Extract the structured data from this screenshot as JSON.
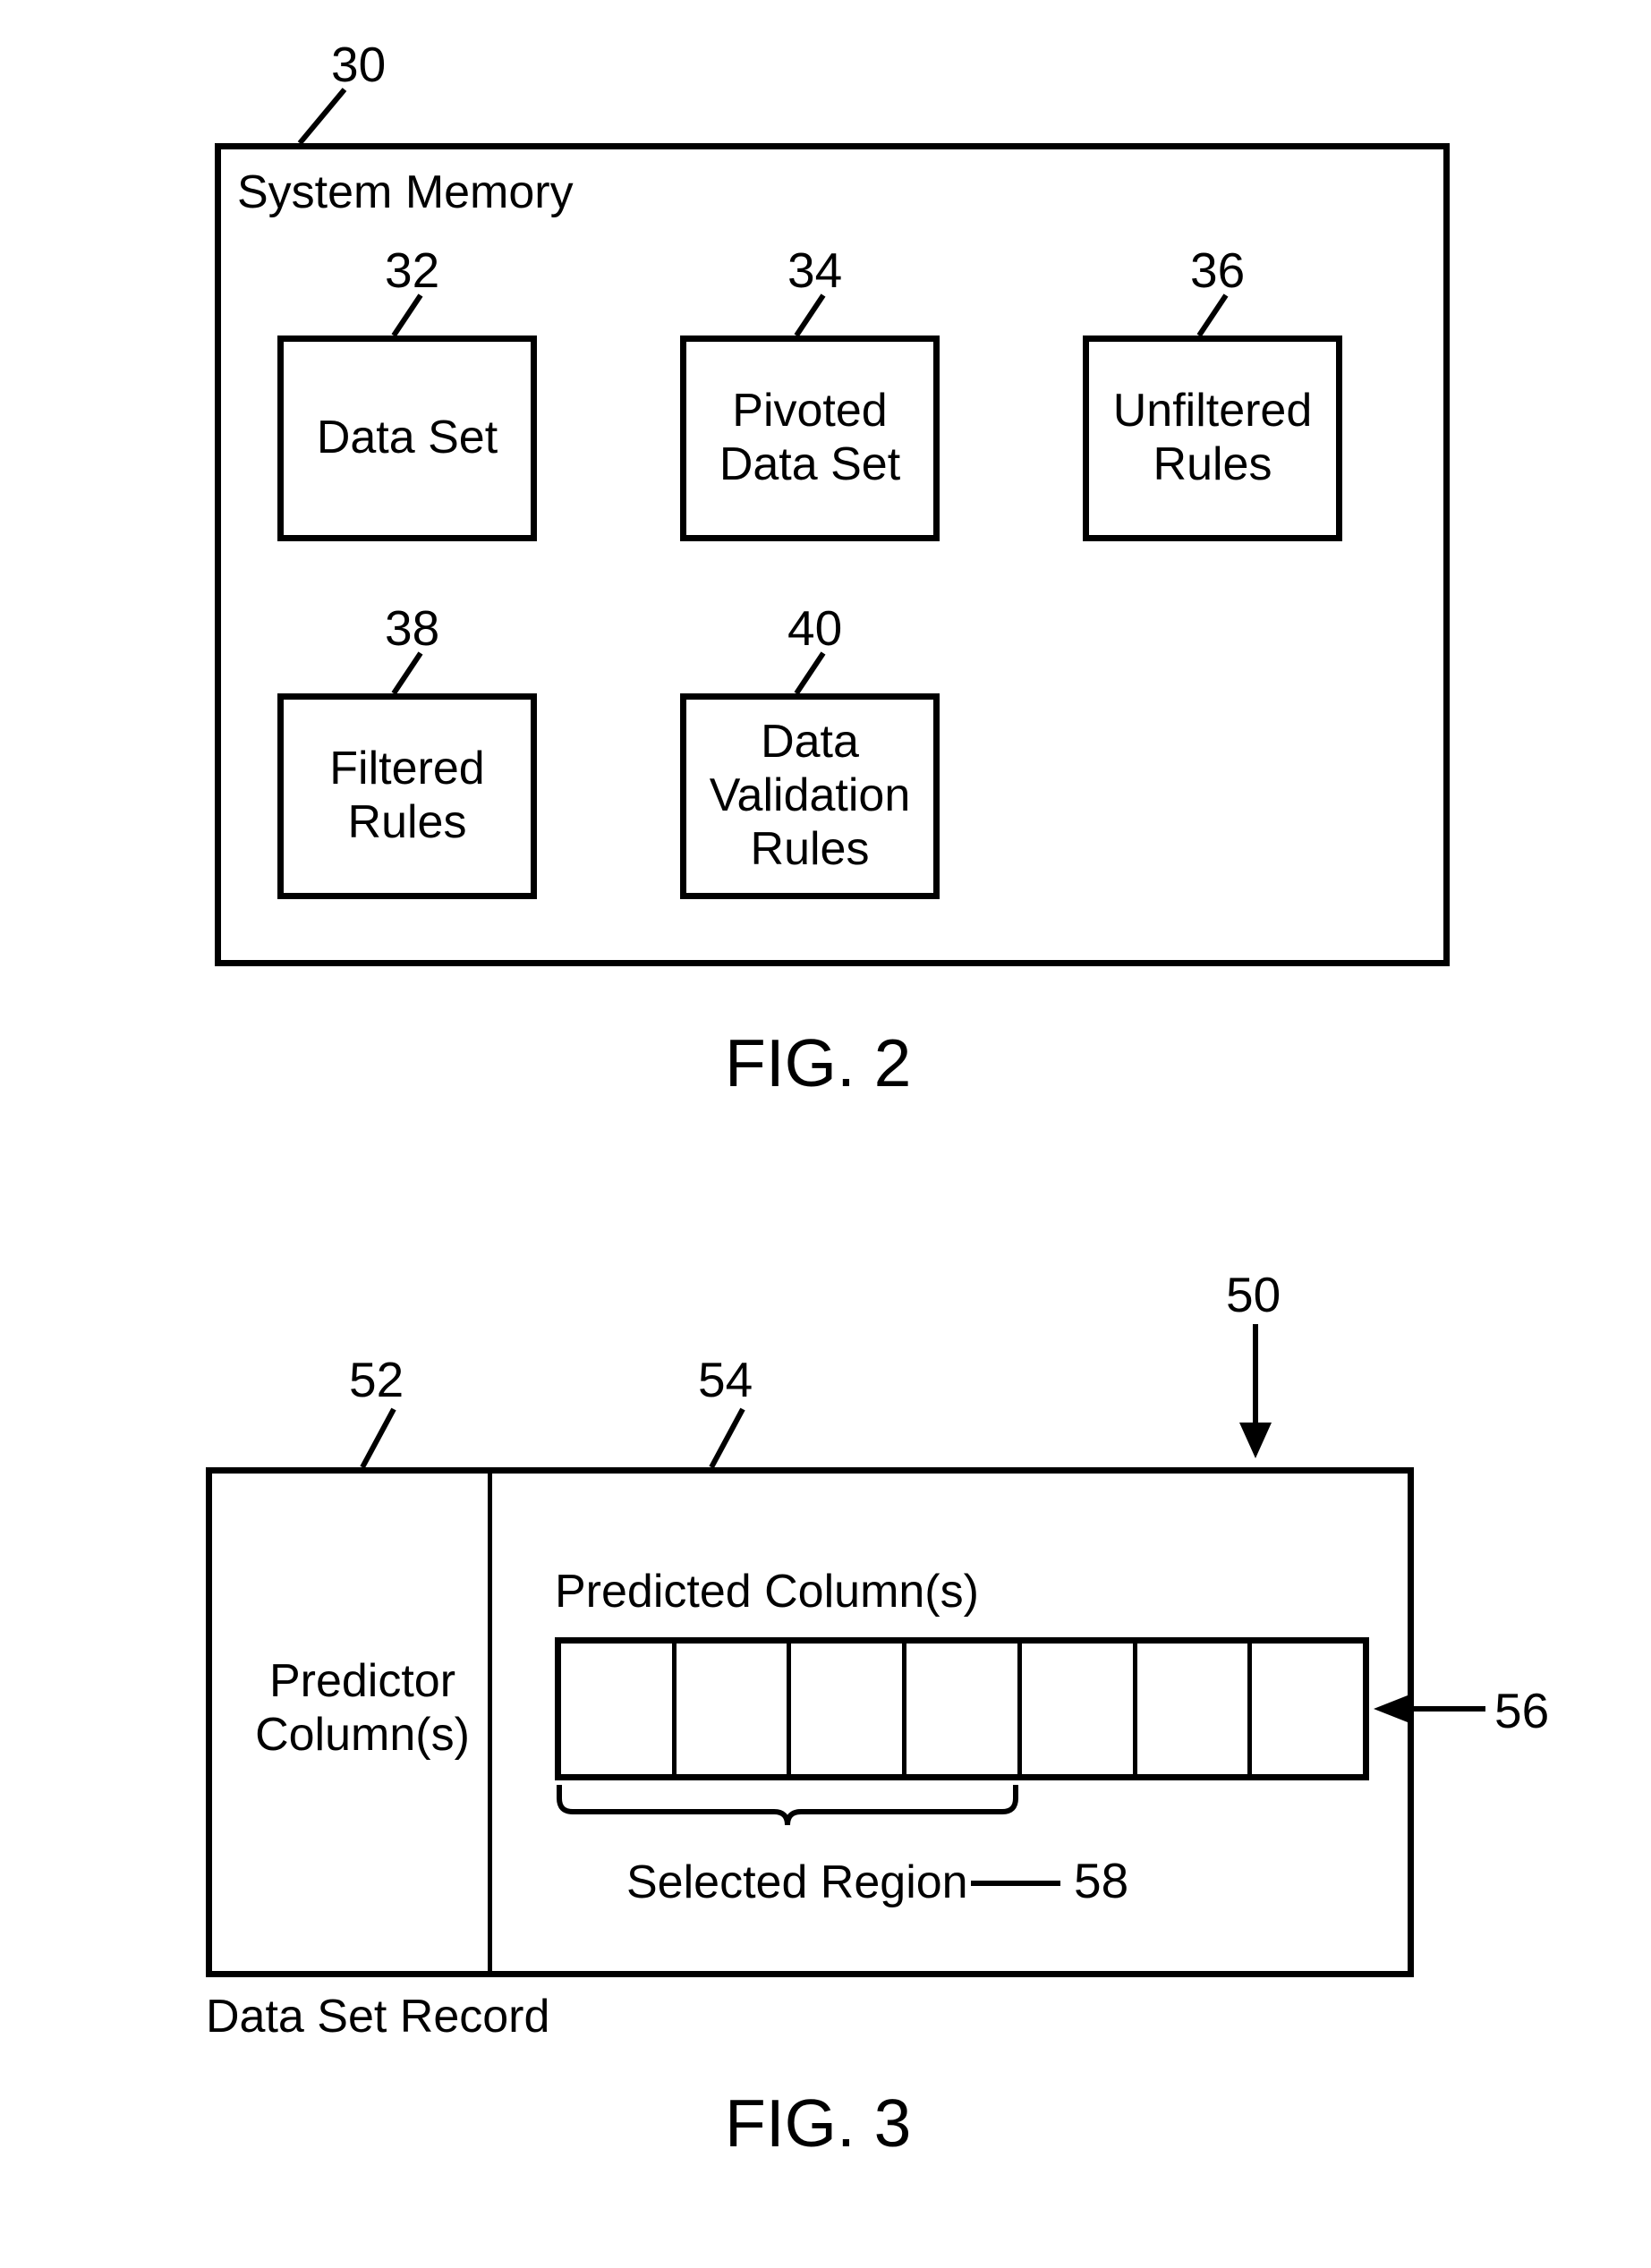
{
  "fig2": {
    "outerLabel": "30",
    "title": "System Memory",
    "boxes": {
      "dataSet": {
        "num": "32",
        "label": "Data Set"
      },
      "pivoted": {
        "num": "34",
        "label": "Pivoted\nData Set"
      },
      "unfiltered": {
        "num": "36",
        "label": "Unfiltered\nRules"
      },
      "filtered": {
        "num": "38",
        "label": "Filtered\nRules"
      },
      "validation": {
        "num": "40",
        "label": "Data\nValidation\nRules"
      }
    },
    "caption": "FIG. 2"
  },
  "fig3": {
    "outerLabel": "50",
    "predictorNum": "52",
    "predictedNum": "54",
    "cellsNum": "56",
    "regionNum": "58",
    "predictorLabel": "Predictor\nColumn(s)",
    "predictedLabel": "Predicted Column(s)",
    "selectedRegionLabel": "Selected Region",
    "recordLabel": "Data Set Record",
    "caption": "FIG. 3"
  }
}
